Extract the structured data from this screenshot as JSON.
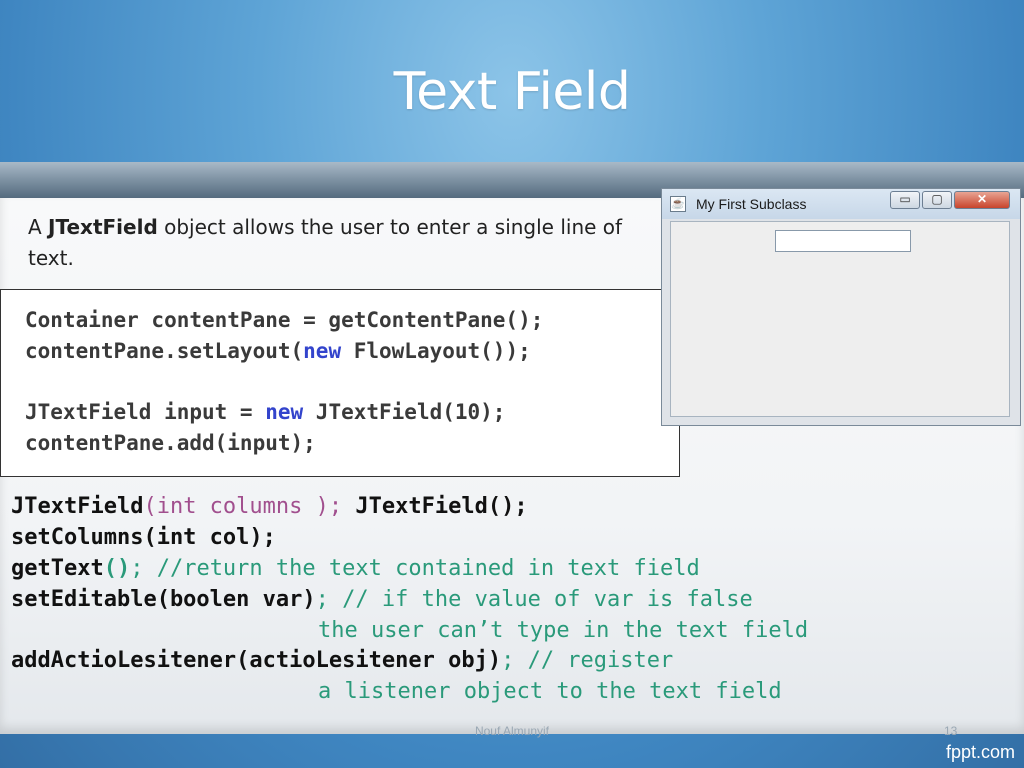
{
  "slide": {
    "title": "Text Field",
    "description": {
      "prefix": "A ",
      "bold_term": "JTextField",
      "suffix": " object allows the user to enter a single line of text."
    },
    "code": [
      {
        "pre": "Container contentPane = getContentPane();",
        "kw": "",
        "post": ""
      },
      {
        "pre": "contentPane.setLayout(",
        "kw": "new",
        "post": " FlowLayout());"
      },
      {
        "pre": "JTextField input = ",
        "kw": "new",
        "post": " JTextField(10);"
      },
      {
        "pre": "contentPane.add(input);",
        "kw": "",
        "post": ""
      }
    ],
    "java_window": {
      "title": "My First Subclass",
      "minimize_glyph": "▭",
      "maximize_glyph": "▢",
      "close_glyph": "✕",
      "field_value": "",
      "icon": "java-cup-icon"
    },
    "api": {
      "line1": {
        "a": "JTextField",
        "b": "(int columns );",
        "c": " JTextField();"
      },
      "line2": "setColumns(int col);",
      "line3": {
        "a": "getText",
        "b": "()",
        "c": "; //return the text contained in text field"
      },
      "line4": {
        "a": "setEditable(boolen var)",
        "b": "; // if the value of var is false"
      },
      "line5": "the user can’t type in the text field",
      "line6": {
        "a": "addActioLesitener(actioLesitener obj)",
        "b": "; // register"
      },
      "line7": "a listener object to the text field"
    },
    "footer": {
      "author": "Nouf Almunyif",
      "page_number": "13",
      "brand": "fppt.com"
    }
  }
}
